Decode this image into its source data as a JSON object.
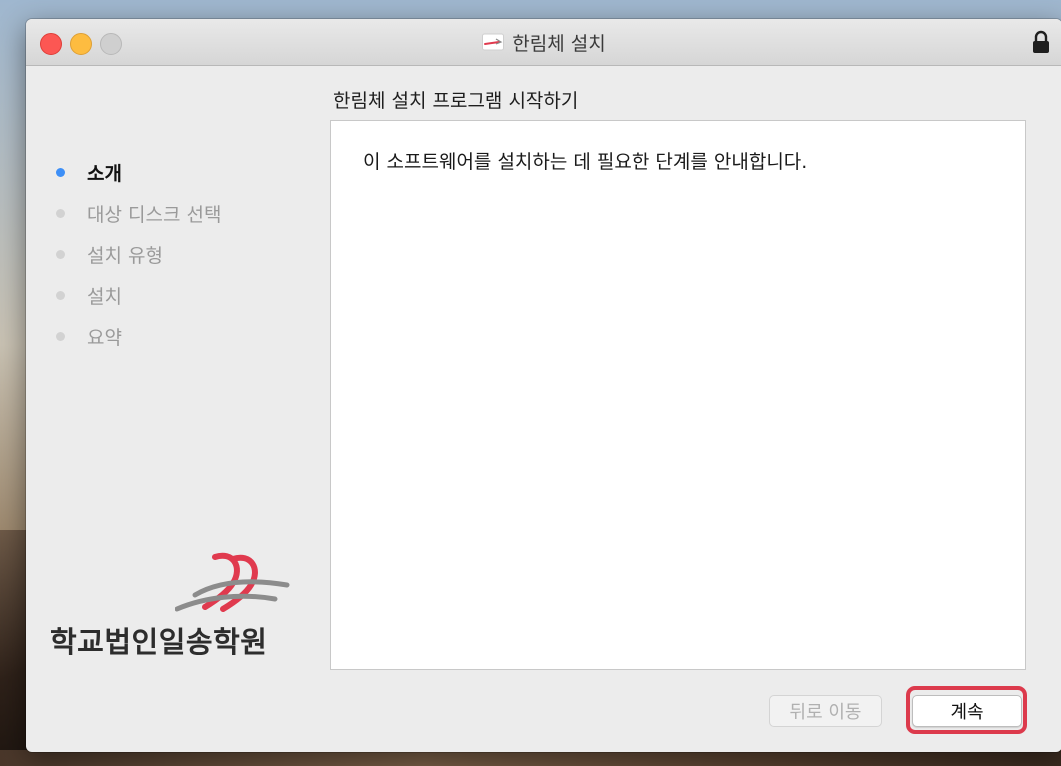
{
  "window": {
    "title": "한림체 설치",
    "controls": [
      "close",
      "minimize",
      "zoom"
    ],
    "app_icon": "pen-stroke-icon",
    "lock_icon": "lock-icon"
  },
  "steps": [
    {
      "label": "소개",
      "active": true
    },
    {
      "label": "대상 디스크 선택",
      "active": false
    },
    {
      "label": "설치 유형",
      "active": false
    },
    {
      "label": "설치",
      "active": false
    },
    {
      "label": "요약",
      "active": false
    }
  ],
  "logo": {
    "text": "학교법인일송학원"
  },
  "main": {
    "title": "한림체 설치 프로그램 시작하기",
    "message": "이 소프트웨어를 설치하는 데 필요한 단계를 안내합니다."
  },
  "buttons": {
    "back_label": "뒤로 이동",
    "continue_label": "계속"
  },
  "colors": {
    "active_step_dot": "#3d8ff7",
    "inactive_step_dot": "#d2d2d2",
    "highlight": "#dc3a4c",
    "logo_red": "#e03a4e",
    "logo_gray": "#8c8c8c"
  }
}
